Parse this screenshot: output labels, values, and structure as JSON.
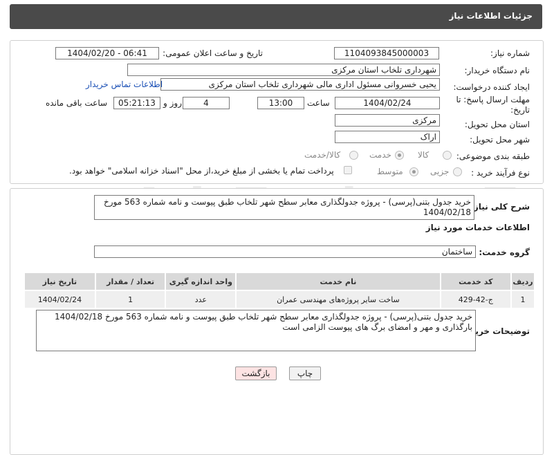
{
  "header": {
    "title": "جزئیات اطلاعات نیاز"
  },
  "form": {
    "need_number_label": "شماره نیاز:",
    "need_number": "1104093845000003",
    "announce_label": "تاریخ و ساعت اعلان عمومی:",
    "announce_value": "1404/02/20 - 06:41",
    "buyer_org_label": "نام دستگاه خریدار:",
    "buyer_org": "شهرداری تلخاب استان مرکزی",
    "creator_label": "ایجاد کننده درخواست:",
    "creator": "یحیی خسروانی مسئول اداری مالی  شهرداری تلخاب استان مرکزی",
    "contact_link": "اطلاعات تماس خریدار",
    "deadline_label": "مهلت ارسال پاسخ: تا تاریخ:",
    "deadline_date": "1404/02/24",
    "time_label": "ساعت",
    "deadline_time": "13:00",
    "days_value": "4",
    "days_label": "روز و",
    "remaining_time": "05:21:13",
    "remaining_label": "ساعت باقی مانده",
    "province_label": "استان محل تحویل:",
    "province": "مرکزی",
    "city_label": "شهر محل تحویل:",
    "city": "اراک",
    "category_label": "طبقه بندی موضوعی:",
    "category_options": [
      "کالا",
      "خدمت",
      "کالا/خدمت"
    ],
    "category_selected": "خدمت",
    "process_label": "نوع فرآیند خرید :",
    "process_options": [
      "جزیی",
      "متوسط"
    ],
    "process_selected": "متوسط",
    "treasury_note": "پرداخت تمام یا بخشی از مبلغ خرید،از محل \"اسناد خزانه اسلامی\" خواهد بود."
  },
  "summary": {
    "label": "شرح کلی نیاز:",
    "text": "خرید جدول بتنی(پرسی) - پروژه جدولگذاری معابر سطح شهر تلخاب طبق پیوست و نامه شماره 563 مورخ 1404/02/18"
  },
  "services": {
    "section_title": "اطلاعات خدمات مورد نیاز",
    "group_label": "گروه خدمت:",
    "group_value": "ساختمان",
    "columns": [
      "ردیف",
      "کد خدمت",
      "نام خدمت",
      "واحد اندازه گیری",
      "تعداد / مقدار",
      "تاریخ نیاز"
    ],
    "rows": [
      {
        "row": "1",
        "code": "ج-42-429",
        "name": "ساخت سایر پروژه‌های مهندسی عمران",
        "unit": "عدد",
        "qty": "1",
        "date": "1404/02/24"
      }
    ]
  },
  "buyer_notes": {
    "label": "توضیحات خریدار:",
    "line1": "خرید جدول بتنی(پرسی) - پروژه جدولگذاری معابر سطح شهر تلخاب طبق پیوست و نامه شماره 563 مورخ 1404/02/18",
    "line2": "بارگذاری و مهر و امضای برگ های پیوست الزامی است"
  },
  "buttons": {
    "print": "چاپ",
    "back": "بازگشت"
  },
  "watermark": "AriaTender.neT",
  "colors": {
    "header_bg": "#4a4a4a",
    "link": "#1a4fb5",
    "back_button_bg": "#fde3e3"
  }
}
